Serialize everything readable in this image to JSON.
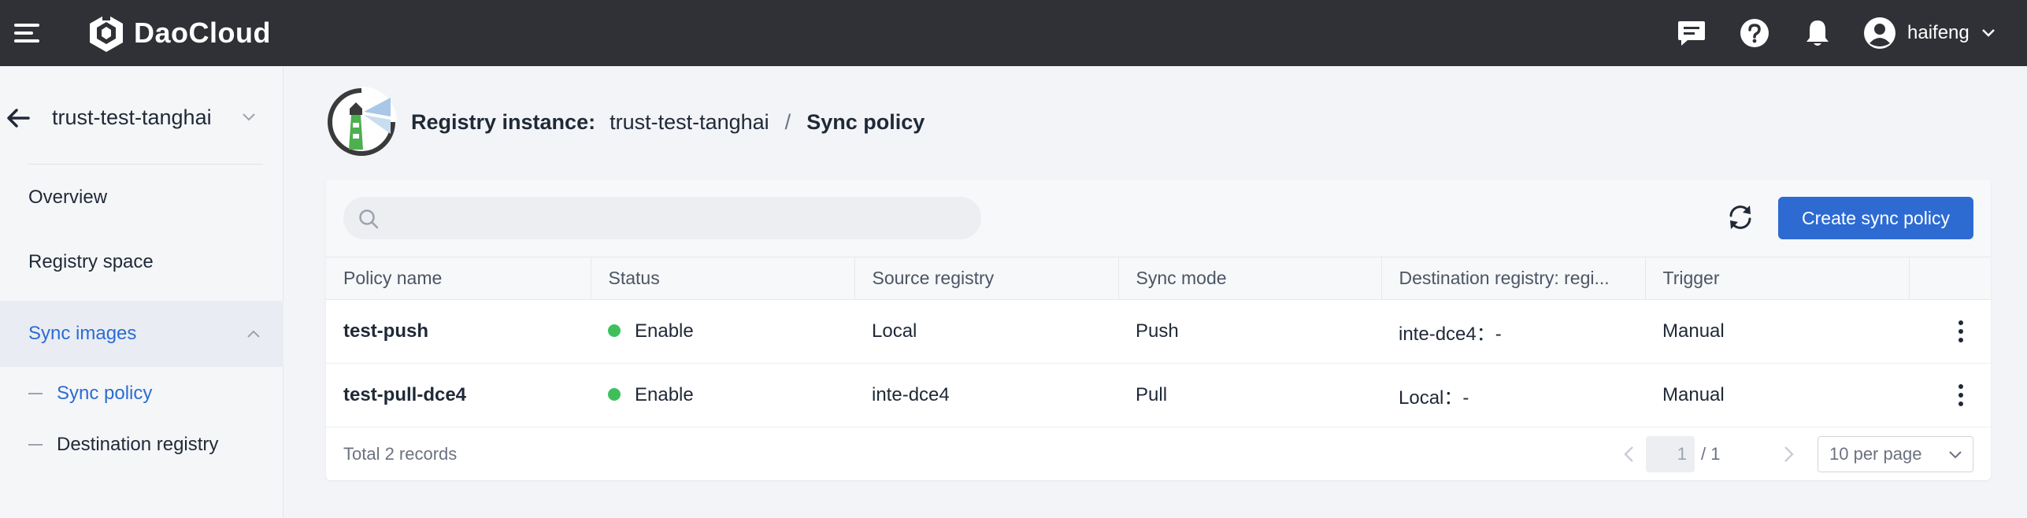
{
  "topbar": {
    "brand": "DaoCloud",
    "user_name": "haifeng",
    "icons": [
      "menu-icon",
      "message-icon",
      "help-icon",
      "notification-icon",
      "user-avatar-icon",
      "chevron-down-icon"
    ]
  },
  "sidebar": {
    "instance_name": "trust-test-tanghai",
    "items": [
      {
        "label": "Overview"
      },
      {
        "label": "Registry space"
      },
      {
        "label": "Sync images"
      }
    ],
    "sub_items": [
      {
        "label": "Sync policy",
        "active": true
      },
      {
        "label": "Destination registry",
        "active": false
      }
    ]
  },
  "breadcrumb": {
    "label": "Registry instance:",
    "instance": "trust-test-tanghai",
    "separator": "/",
    "current": "Sync policy"
  },
  "toolbar": {
    "search_placeholder": "",
    "create_label": "Create sync policy"
  },
  "table": {
    "columns": [
      "Policy name",
      "Status",
      "Source registry",
      "Sync mode",
      "Destination registry: regi...",
      "Trigger",
      ""
    ],
    "rows": [
      {
        "name": "test-push",
        "status": "Enable",
        "source": "Local",
        "mode": "Push",
        "destination": "inte-dce4：-",
        "trigger": "Manual"
      },
      {
        "name": "test-pull-dce4",
        "status": "Enable",
        "source": "inte-dce4",
        "mode": "Pull",
        "destination": "Local：-",
        "trigger": "Manual"
      }
    ]
  },
  "pagination": {
    "total_text": "Total 2 records",
    "current_page": "1",
    "total_pages": "/ 1",
    "per_page": "10 per page"
  },
  "colors": {
    "topbar_bg": "#2f3136",
    "primary": "#2d6bd3",
    "status_enabled": "#3fbf5c"
  }
}
